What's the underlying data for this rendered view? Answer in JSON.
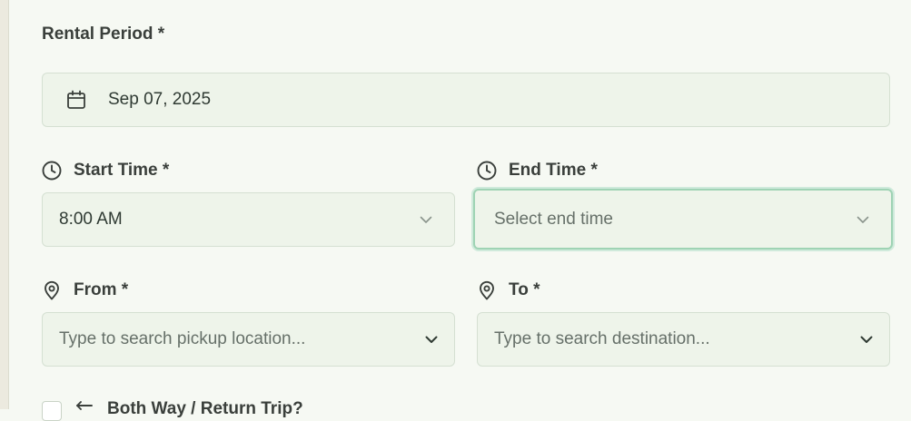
{
  "rental_period": {
    "label": "Rental Period *",
    "date_value": "Sep 07, 2025"
  },
  "start_time": {
    "label": "Start Time *",
    "value": "8:00 AM"
  },
  "end_time": {
    "label": "End Time *",
    "placeholder": "Select end time"
  },
  "from": {
    "label": "From *",
    "placeholder": "Type to search pickup location..."
  },
  "to": {
    "label": "To *",
    "placeholder": "Type to search destination..."
  },
  "return_trip": {
    "label": "Both Way / Return Trip?"
  },
  "icons": {
    "date": "calendar-icon",
    "time": "clock-icon",
    "location": "map-pin-icon",
    "dropdown": "chevron-down-icon",
    "return": "arrow-left-icon"
  },
  "colors": {
    "background": "#f6f9f3",
    "field_background": "#eef4ea",
    "field_border": "#d5e0d2",
    "focus_ring": "#9fd3b4"
  }
}
